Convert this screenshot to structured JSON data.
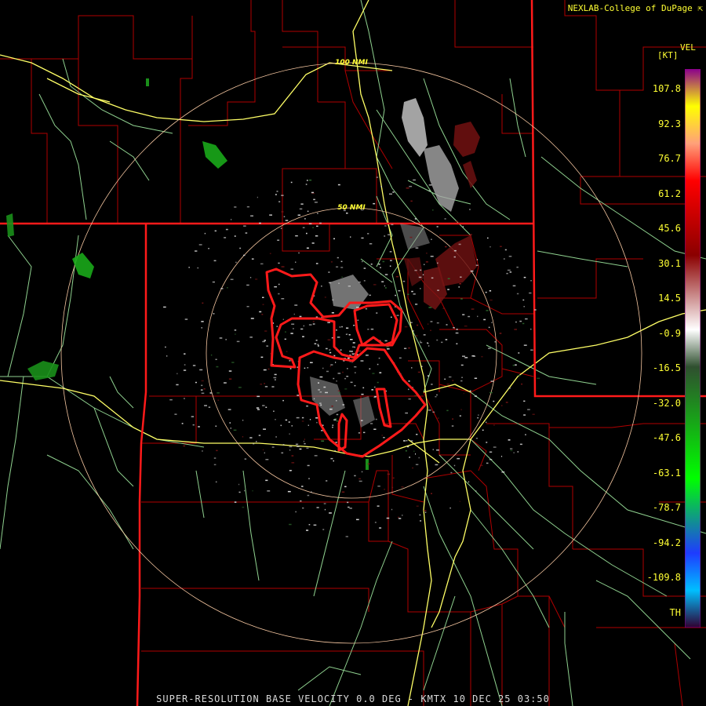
{
  "header": {
    "credit": "NEXLAB-College of DuPage",
    "credit_icon": "external-link-icon"
  },
  "footer": {
    "product_line": "SUPER-RESOLUTION BASE VELOCITY 0.0 DEG - KMTX 10 DEC 25 03:50"
  },
  "range_rings": [
    {
      "label": "100 NMI"
    },
    {
      "label": "50 NMI"
    }
  ],
  "legend": {
    "title": "VEL",
    "units": "[KT]",
    "ticks": [
      "107.8",
      "92.3",
      "76.7",
      "61.2",
      "45.6",
      "30.1",
      "14.5",
      "-0.9",
      "-16.5",
      "-32.0",
      "-47.6",
      "-63.1",
      "-78.7",
      "-94.2",
      "-109.8",
      "TH"
    ],
    "color_stops": [
      {
        "value": "107.8",
        "color": "#8b008b"
      },
      {
        "value": "92.3",
        "color": "#ffff00"
      },
      {
        "value": "76.7",
        "color": "#ffa07a"
      },
      {
        "value": "61.2",
        "color": "#ff0000"
      },
      {
        "value": "30.1",
        "color": "#8b0000"
      },
      {
        "value": "-0.9",
        "color": "#ffffff"
      },
      {
        "value": "-16.5",
        "color": "#2f4f2f"
      },
      {
        "value": "-63.1",
        "color": "#00ff00"
      },
      {
        "value": "-94.2",
        "color": "#1e3cff"
      },
      {
        "value": "-109.8",
        "color": "#00bfff"
      },
      {
        "value": "TH",
        "color": "#300030"
      }
    ]
  },
  "colors": {
    "state_border": "#ff1a1a",
    "county_border": "#b00000",
    "highway": "#ffff66",
    "road": "#8fd18f",
    "range_ring": "#f5c6a0",
    "warning_polygon": "#ff1a1a",
    "label": "#ffff33",
    "footer_text": "#d9d9d9"
  }
}
